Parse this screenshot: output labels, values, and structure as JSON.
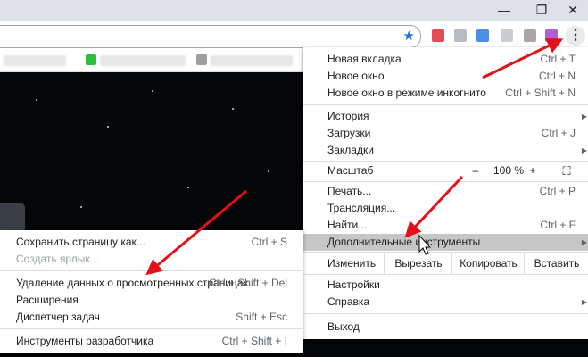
{
  "window": {
    "controls": [
      "—",
      "❐",
      "✕"
    ]
  },
  "menu": {
    "items": [
      {
        "label": "Новая вкладка",
        "shortcut": "Ctrl + T"
      },
      {
        "label": "Новое окно",
        "shortcut": "Ctrl + N"
      },
      {
        "label": "Новое окно в режиме инкогнито",
        "shortcut": "Ctrl + Shift + N"
      },
      {
        "label": "История",
        "shortcut": ""
      },
      {
        "label": "Загрузки",
        "shortcut": "Ctrl + J"
      },
      {
        "label": "Закладки",
        "shortcut": ""
      }
    ],
    "zoom": {
      "label": "Масштаб",
      "minus": "–",
      "value": "100 %",
      "plus": "+"
    },
    "items2": [
      {
        "label": "Печать...",
        "shortcut": "Ctrl + P"
      },
      {
        "label": "Трансляция...",
        "shortcut": ""
      },
      {
        "label": "Найти...",
        "shortcut": "Ctrl + F"
      },
      {
        "label": "Дополнительные инструменты",
        "shortcut": ""
      }
    ],
    "edit": {
      "label": "Изменить",
      "cut": "Вырезать",
      "copy": "Копировать",
      "paste": "Вставить"
    },
    "items3": [
      {
        "label": "Настройки"
      },
      {
        "label": "Справка"
      },
      {
        "label": "Выход"
      }
    ]
  },
  "submenu": {
    "items": [
      {
        "label": "Сохранить страницу как...",
        "shortcut": "Ctrl + S"
      },
      {
        "label": "Создать ярлык...",
        "shortcut": ""
      },
      {
        "label": "Удаление данных о просмотренных страницах...",
        "shortcut": "Ctrl + Shift + Del"
      },
      {
        "label": "Расширения",
        "shortcut": ""
      },
      {
        "label": "Диспетчер задач",
        "shortcut": "Shift + Esc"
      },
      {
        "label": "Инструменты разработчика",
        "shortcut": "Ctrl + Shift + I"
      }
    ]
  },
  "colors": {
    "highlight": "#c6c6c6",
    "arrow": "#e3101a",
    "accent": "#1a73e8"
  },
  "icons": {
    "bookmark": "star-icon",
    "menu": "kebab-menu-icon",
    "submenu": "chevron-right-icon"
  }
}
